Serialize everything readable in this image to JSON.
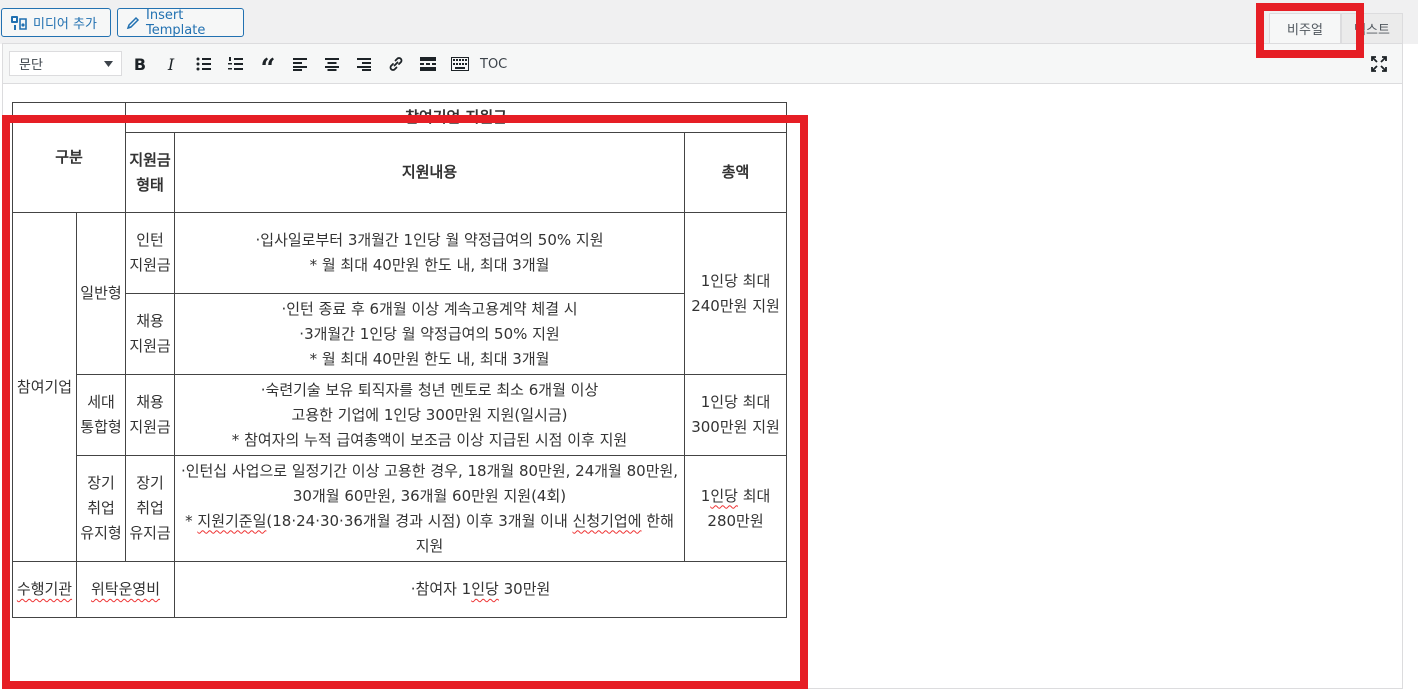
{
  "media_buttons": {
    "add_media": "미디어 추가",
    "insert_template": "Insert Template"
  },
  "editor_tabs": {
    "visual": "비주얼",
    "text": "텍스트"
  },
  "toolbar": {
    "format_select": "문단",
    "toc": "TOC",
    "icons": [
      "bold-icon",
      "italic-icon",
      "bullet-list-icon",
      "numbered-list-icon",
      "blockquote-icon",
      "align-left-icon",
      "align-center-icon",
      "align-right-icon",
      "link-icon",
      "read-more-icon",
      "toolbar-toggle-icon",
      "fullscreen-icon"
    ]
  },
  "table": {
    "header": {
      "division": "구분",
      "group": "참여기업 지원금",
      "type": "지원금 형태",
      "content": "지원내용",
      "total": "총액"
    },
    "company": "참여기업",
    "general": "일반형",
    "intern_support": "인턴 지원금",
    "intern_content_1": "·입사일로부터 3개월간 1인당 월 약정급여의 50% 지원",
    "intern_content_2": "* 월 최대 40만원 한도 내, 최대 3개월",
    "general_total": "1인당 최대 240만원 지원",
    "hire_support": "채용 지원금",
    "hire_content_1": "·인턴 종료 후 6개월 이상 계속고용계약 체결 시",
    "hire_content_2": "·3개월간 1인당 월 약정급여의 50% 지원",
    "hire_content_3": "* 월 최대 40만원 한도 내, 최대 3개월",
    "intergen": "세대 통합형",
    "intergen_support": "채용 지원금",
    "intergen_content_1": "·숙련기술 보유 퇴직자를 청년 멘토로 최소 6개월 이상",
    "intergen_content_2": "고용한 기업에 1인당 300만원 지원(일시금)",
    "intergen_content_3": "* 참여자의 누적 급여총액이 보조금 이상 지급된 시점 이후 지원",
    "intergen_total": "1인당 최대 300만원 지원",
    "longterm": "장기 취업 유지형",
    "longterm_support": "장기 취업 유지금",
    "longterm_content_1": "·인턴십 사업으로 일정기간 이상 고용한 경우, 18개월 80만원, 24개월 80만원, 30개월 60만원, 36개월 60만원 지원(4회)",
    "longterm_content_2a": "* ",
    "longterm_content_2b": "지원기준일",
    "longterm_content_2c": "(18·24·30·36개월 경과 시점) 이후 3개월 이내 ",
    "longterm_content_2d": "신청기업에",
    "longterm_content_2e": " 한해 지원",
    "longterm_total_a": "1",
    "longterm_total_b": "인당",
    "longterm_total_c": " 최대 280만원",
    "agency": "수행기관",
    "entrust": "위탁운영비",
    "agency_content_a": "·참여자 1",
    "agency_content_b": "인당",
    "agency_content_c": " 30만원"
  }
}
